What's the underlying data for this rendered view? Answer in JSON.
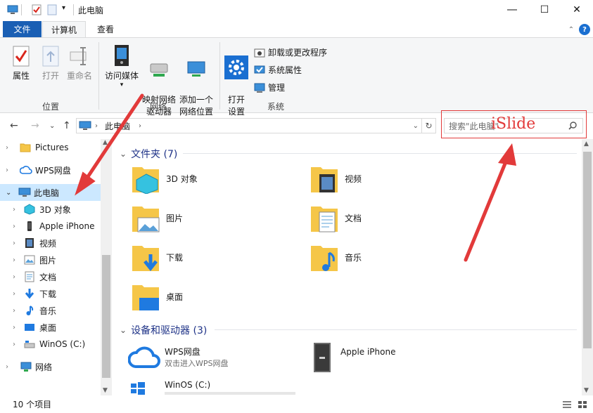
{
  "window": {
    "title": "此电脑"
  },
  "tabs": {
    "file": "文件",
    "computer": "计算机",
    "view": "查看"
  },
  "ribbon": {
    "location": {
      "label": "位置",
      "properties": "属性",
      "open": "打开",
      "rename": "重命名"
    },
    "network": {
      "label": "网络",
      "access_media": "访问媒体",
      "map_drive": "映射网络\n驱动器",
      "add_location": "添加一个\n网络位置"
    },
    "system": {
      "label": "系统",
      "open_settings": "打开\n设置",
      "uninstall": "卸载或更改程序",
      "system_properties": "系统属性",
      "manage": "管理"
    }
  },
  "address": {
    "path": "此电脑",
    "search_placeholder": "搜索\"此电脑\""
  },
  "watermark": "iSlide",
  "nav_items": [
    {
      "label": "Pictures"
    },
    {
      "label": "WPS网盘"
    },
    {
      "label": "此电脑"
    },
    {
      "label": "3D 对象"
    },
    {
      "label": "Apple iPhone"
    },
    {
      "label": "视频"
    },
    {
      "label": "图片"
    },
    {
      "label": "文档"
    },
    {
      "label": "下载"
    },
    {
      "label": "音乐"
    },
    {
      "label": "桌面"
    },
    {
      "label": "WinOS (C:)"
    },
    {
      "label": "网络"
    }
  ],
  "folders_group": {
    "title": "文件夹 (7)"
  },
  "folders": [
    {
      "label": "3D 对象"
    },
    {
      "label": "视频"
    },
    {
      "label": "图片"
    },
    {
      "label": "文档"
    },
    {
      "label": "下载"
    },
    {
      "label": "音乐"
    },
    {
      "label": "桌面"
    }
  ],
  "devices_group": {
    "title": "设备和驱动器 (3)"
  },
  "devices": [
    {
      "label": "WPS网盘",
      "sub": "双击进入WPS网盘"
    },
    {
      "label": "Apple iPhone"
    },
    {
      "label": "WinOS (C:)"
    }
  ],
  "status": {
    "count": "10 个项目"
  },
  "colors": {
    "accent": "#1a5fb4",
    "selection": "#cce8ff",
    "annotation": "#e23a3a",
    "group_header": "#1e3287"
  }
}
